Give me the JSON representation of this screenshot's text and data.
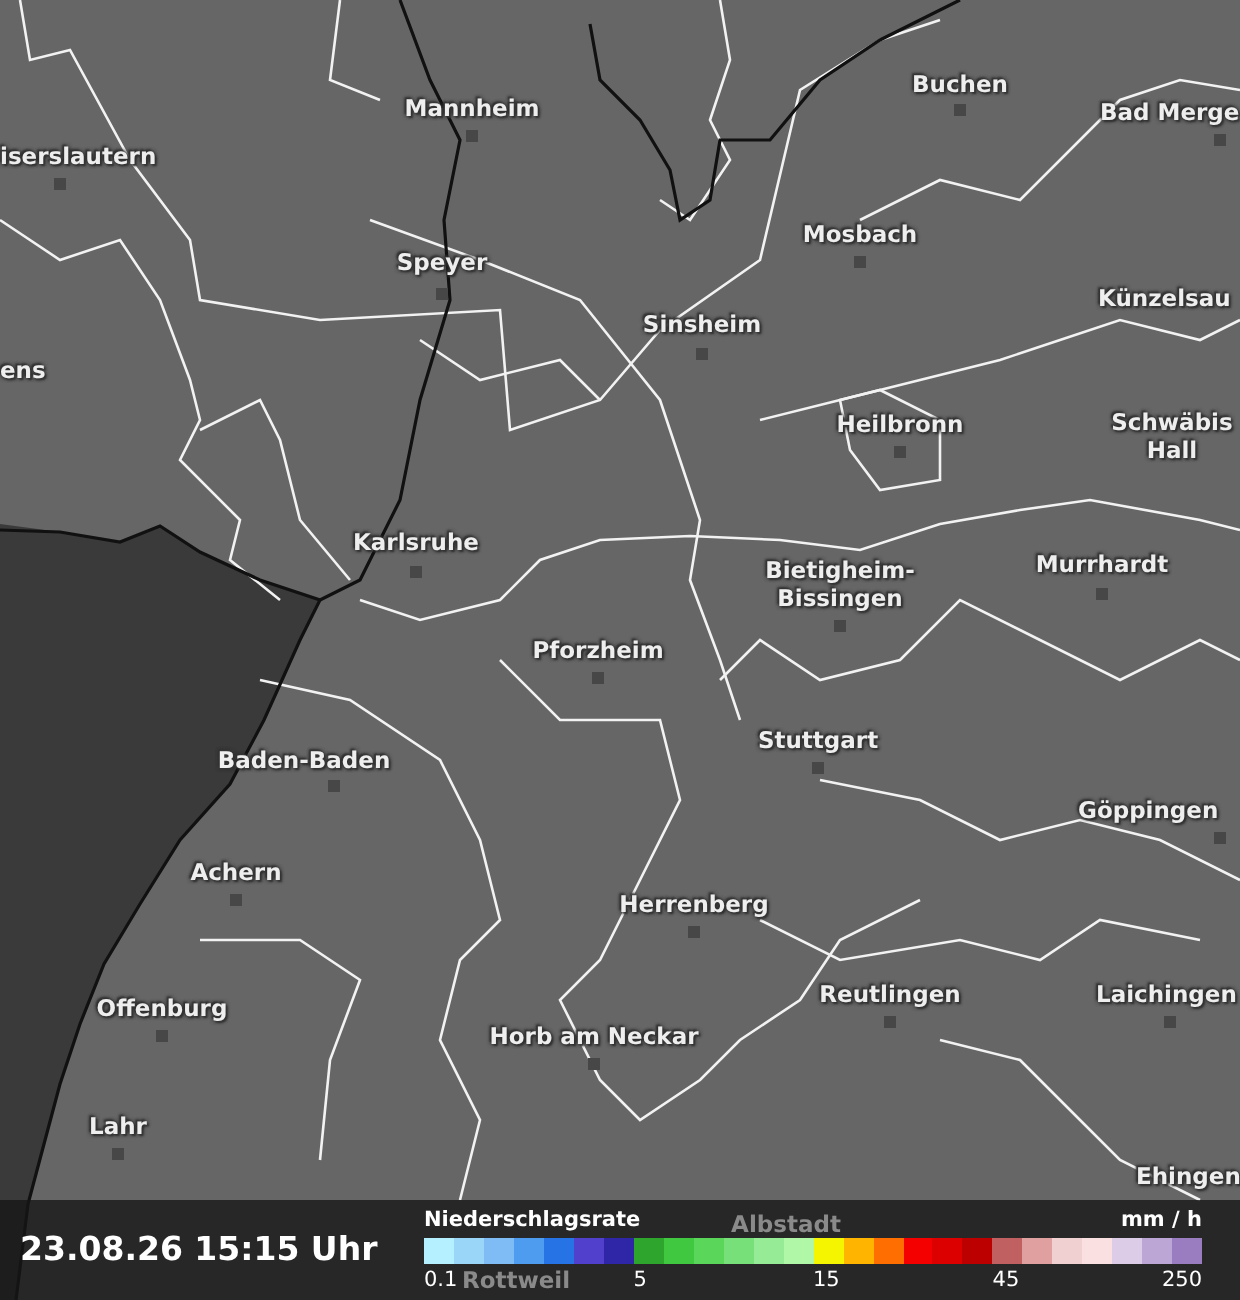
{
  "map": {
    "cities": [
      {
        "name": "Mannheim"
      },
      {
        "name": "iserslautern"
      },
      {
        "name": "Buchen"
      },
      {
        "name": "Bad Merge"
      },
      {
        "name": "Speyer"
      },
      {
        "name": "Mosbach"
      },
      {
        "name": "Künzelsau"
      },
      {
        "name": "Sinsheim"
      },
      {
        "name": "ens"
      },
      {
        "name": "Heilbronn"
      },
      {
        "name": "Schwäbis\nHall"
      },
      {
        "name": "Karlsruhe"
      },
      {
        "name": "Bietigheim-\nBissingen"
      },
      {
        "name": "Murrhardt"
      },
      {
        "name": "Pforzheim"
      },
      {
        "name": "Baden-Baden"
      },
      {
        "name": "Stuttgart"
      },
      {
        "name": "Göppingen"
      },
      {
        "name": "Achern"
      },
      {
        "name": "Herrenberg"
      },
      {
        "name": "Reutlingen"
      },
      {
        "name": "Laichingen"
      },
      {
        "name": "Offenburg"
      },
      {
        "name": "Horb am Neckar"
      },
      {
        "name": "Lahr"
      },
      {
        "name": "Ehingen"
      },
      {
        "name": "Albstadt"
      },
      {
        "name": "Rottweil"
      }
    ]
  },
  "timestamp": "23.08.26 15:15 Uhr",
  "legend": {
    "title": "Niederschlagsrate",
    "unit": "mm / h",
    "cells": [
      {
        "color": "#b4f0ff"
      },
      {
        "color": "#9ad6f8"
      },
      {
        "color": "#7fbcf5"
      },
      {
        "color": "#4d9cf0"
      },
      {
        "color": "#2673e6"
      },
      {
        "color": "#5040cc"
      },
      {
        "color": "#2e26a6"
      },
      {
        "color": "#2ea62e"
      },
      {
        "color": "#40c840"
      },
      {
        "color": "#5ad65a"
      },
      {
        "color": "#78e078"
      },
      {
        "color": "#96ec96"
      },
      {
        "color": "#b0f8a8"
      },
      {
        "color": "#f5f500"
      },
      {
        "color": "#ffb400"
      },
      {
        "color": "#ff6e00"
      },
      {
        "color": "#f50000"
      },
      {
        "color": "#dc0000"
      },
      {
        "color": "#bc0000"
      },
      {
        "color": "#c06060"
      },
      {
        "color": "#e0a0a0"
      },
      {
        "color": "#f0d0d0"
      },
      {
        "color": "#fae0e0"
      },
      {
        "color": "#dccce8"
      },
      {
        "color": "#bca6d6"
      },
      {
        "color": "#9a7cc0"
      }
    ],
    "ticks": [
      {
        "label": "0.1"
      },
      {
        "label": "5"
      },
      {
        "label": "15"
      },
      {
        "label": "45"
      },
      {
        "label": "250"
      }
    ]
  }
}
